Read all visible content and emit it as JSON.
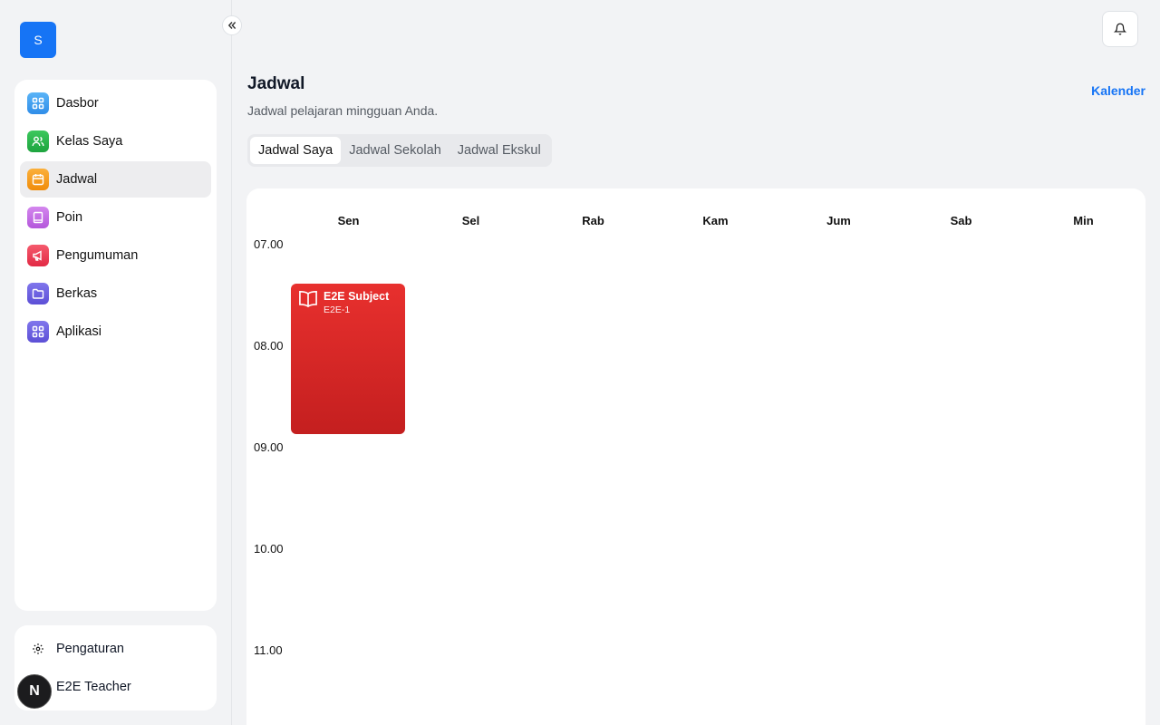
{
  "app": {
    "logo_letter": "S"
  },
  "sidebar": {
    "items": [
      {
        "label": "Dasbor",
        "icon": "dashboard-icon",
        "color": "#3b9bf2"
      },
      {
        "label": "Kelas Saya",
        "icon": "users-icon",
        "color": "#22b14c"
      },
      {
        "label": "Jadwal",
        "icon": "calendar-icon",
        "color": "#f59e0b",
        "active": true
      },
      {
        "label": "Poin",
        "icon": "book-icon",
        "color": "#c26ce6"
      },
      {
        "label": "Pengumuman",
        "icon": "megaphone-icon",
        "color": "#ef3e55"
      },
      {
        "label": "Berkas",
        "icon": "folder-icon",
        "color": "#6b5fe0"
      },
      {
        "label": "Aplikasi",
        "icon": "apps-icon",
        "color": "#6b5fe0"
      }
    ],
    "settings_label": "Pengaturan",
    "user_name": "E2E Teacher",
    "user_avatar_letter": "N"
  },
  "page": {
    "title": "Jadwal",
    "subtitle": "Jadwal pelajaran mingguan Anda.",
    "calendar_link": "Kalender"
  },
  "tabs": [
    {
      "label": "Jadwal Saya",
      "active": true
    },
    {
      "label": "Jadwal Sekolah",
      "active": false
    },
    {
      "label": "Jadwal Ekskul",
      "active": false
    }
  ],
  "schedule": {
    "days": [
      "Sen",
      "Sel",
      "Rab",
      "Kam",
      "Jum",
      "Sab",
      "Min"
    ],
    "times": [
      "07.00",
      "08.00",
      "09.00",
      "10.00",
      "11.00"
    ],
    "events": [
      {
        "title": "E2E Subject",
        "room": "E2E-1",
        "day": "Sen",
        "color": "#e02d2d"
      }
    ]
  }
}
